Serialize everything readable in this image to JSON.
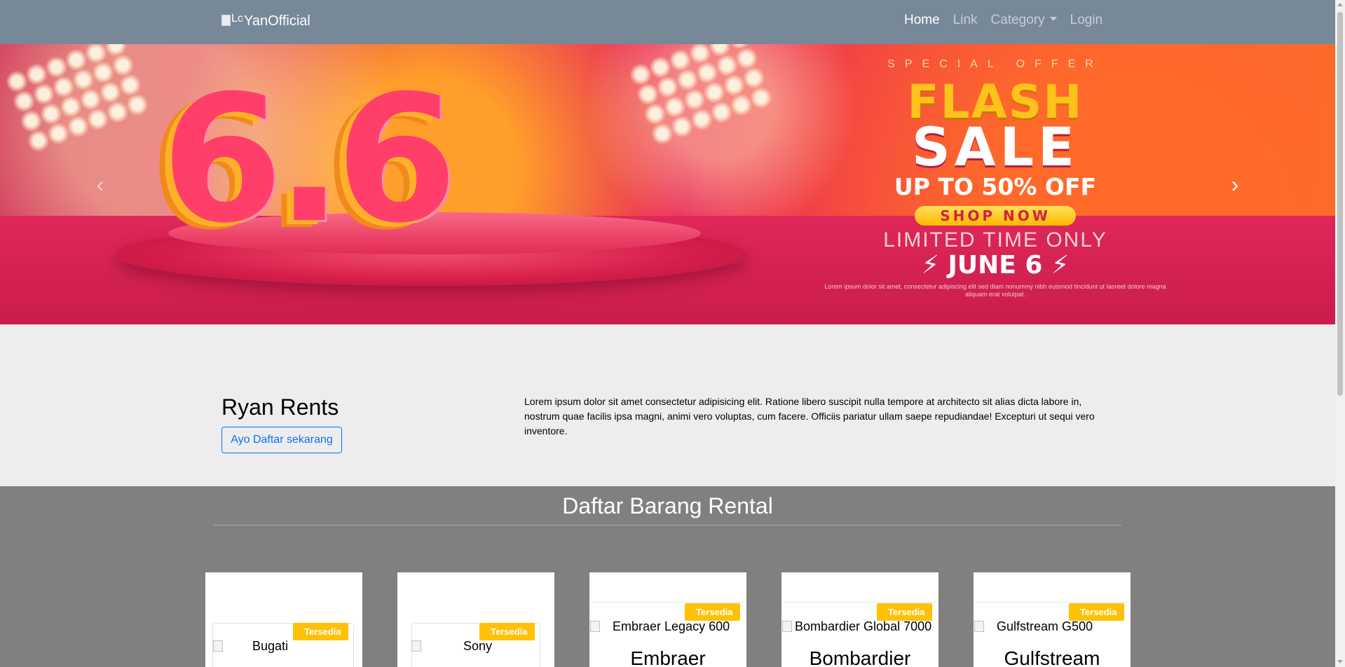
{
  "navbar": {
    "logo_alt": "Lo",
    "brand": "YanOfficial",
    "links": [
      {
        "label": "Home",
        "active": true
      },
      {
        "label": "Link",
        "active": false
      },
      {
        "label": "Category",
        "active": false,
        "dropdown": true
      },
      {
        "label": "Login",
        "active": false
      }
    ],
    "bg_color": "#778899"
  },
  "carousel": {
    "banner": {
      "number": "6.6",
      "special_offer": "SPECIAL OFFER",
      "flash": "FLASH",
      "sale": "SALE",
      "discount": "UP TO 50% OFF",
      "cta": "SHOP NOW",
      "limited": "LIMITED TIME ONLY",
      "date": "JUNE 6",
      "fine_print": "Lorem ipsum dolor sit amet, consectetur adipiscing elit sed diam nonummy nibh euismod tincidunt ut laoreet dolore magna aliquam erat volutpat."
    },
    "prev_icon": "chevron-left-icon",
    "next_icon": "chevron-right-icon"
  },
  "intro": {
    "title": "Ryan Rents",
    "button": "Ayo Daftar sekarang",
    "text": "Lorem ipsum dolor sit amet consectetur adipisicing elit. Ratione libero suscipit nulla tempore at architecto sit alias dicta labore in, nostrum quae facilis ipsa magni, animi vero voluptas, cum facere. Officiis pariatur ullam saepe repudiandae! Excepturi ut sequi vero inventore."
  },
  "rental_list": {
    "title": "Daftar Barang Rental",
    "items": [
      {
        "image_alt": "Bugati",
        "badge": "Tersedia",
        "name": ""
      },
      {
        "image_alt": "Sony",
        "badge": "Tersedia",
        "name": ""
      },
      {
        "image_alt": "Embraer Legacy 600",
        "badge": "Tersedia",
        "name": "Embraer"
      },
      {
        "image_alt": "Bombardier Global 7000",
        "badge": "Tersedia",
        "name": "Bombardier"
      },
      {
        "image_alt": "Gulfstream G500",
        "badge": "Tersedia",
        "name": "Gulfstream"
      }
    ],
    "badge_color": "#ffc107"
  }
}
